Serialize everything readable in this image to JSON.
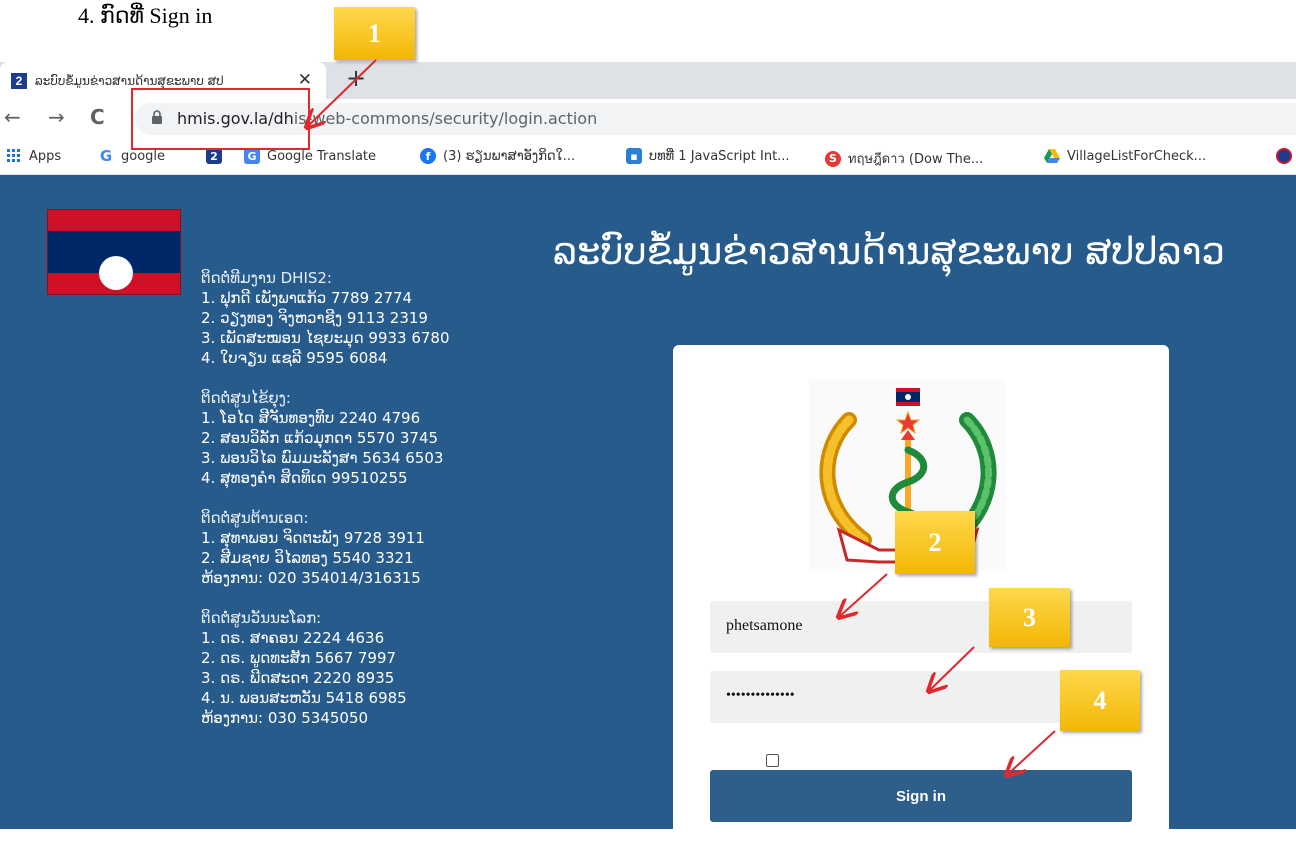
{
  "caption": "4. ກົດທີ່ Sign in",
  "browser": {
    "tab": {
      "favicon": "2",
      "title": "ລະບົບຂໍ້ມູນຂ່າວສານດ້ານສຸຂະພາບ ສປ",
      "close": "✕"
    },
    "new_tab": "+",
    "nav": {
      "back": "←",
      "forward": "→",
      "reload": "C"
    },
    "url_host": "hmis.gov.la/dh",
    "url_path": "is-web-commons/security/login.action",
    "bookmarks": [
      {
        "icon": "apps-grid-icon",
        "label": "Apps"
      },
      {
        "icon": "google-icon",
        "label": "google"
      },
      {
        "icon": "dhis2-icon",
        "label": ""
      },
      {
        "icon": "google-translate-icon",
        "label": "Google Translate"
      },
      {
        "icon": "facebook-icon",
        "label": "(3) ຮຽນພາສາອັງກິດໃ..."
      },
      {
        "icon": "site-icon",
        "label": "ບທທີ່ 1 JavaScript Int..."
      },
      {
        "icon": "si-icon",
        "label": "ทฤษฎีดาว (Dow The..."
      },
      {
        "icon": "google-drive-icon",
        "label": "VillageListForCheck..."
      }
    ]
  },
  "page": {
    "title": "ລະບົບຂໍ້ມູນຂ່າວສານດ້ານສຸຂະພາບ ສປປລາວ",
    "contact_groups": [
      {
        "heading": "ຕິດຕໍ່ທີມງານ DHIS2:",
        "lines": [
          "1. ຟຸກດີ ເພັງພາແກ້ວ 7789 2774",
          "2. ວຽງທອງ ຈິງຫວາຊີງ 9113 2319",
          "3. ເພັດສະໝອນ ໄຊຍະມຸດ 9933 6780",
          "4. ໃບຈຽນ ແຊລີ 9595 6084"
        ]
      },
      {
        "heading": "ຕິດຕໍ່ສູນໄຂ້ຍຸງ:",
        "lines": [
          "1. ໂອໄດ ສີຈັນທອງທິບ 2240 4796",
          "2. ສອນວິລັກ ແກ້ວມຸກດາ 5570 3745",
          "3. ພອນວິໄລ ພົມມະລັງສາ 5634 6503",
          "4. ສຸທອງຄຳ ສິດທິເດ 99510255"
        ]
      },
      {
        "heading": "ຕິດຕໍ່ສູນຕ້ານເອດ:",
        "lines": [
          "1. ສຸທາພອນ ຈິດຕະພັງ 9728 3911",
          "2. ສີມຊາຍ ວິໄລທອງ 5540 3321",
          "ຫ້ອງການ: 020 354014/316315"
        ]
      },
      {
        "heading": "ຕິດຕໍ່ສູນວັນນະໂລກ:",
        "lines": [
          "1. ດຣ. ສາຄອນ 2224 4636",
          "2. ດຣ. ພູດທະສັກ 5667 7997",
          "3. ດຣ. ພີດສະດາ 2220 8935",
          "4. ນ. ພອນສະຫວັນ 5418 6985",
          "ຫ້ອງການ: 030 5345050"
        ]
      }
    ],
    "login": {
      "username_value": "phetsamone",
      "password_value": "••••••••••••••",
      "remember_checked": false,
      "signin_label": "Sign in"
    }
  },
  "annotations": {
    "badges": [
      "1",
      "2",
      "3",
      "4"
    ],
    "highlight_color": "#e0282d",
    "badge_color": "#f2b705"
  },
  "colors": {
    "page_bg": "#275b8c",
    "signin_bg": "#2d5f8a",
    "flag_red": "#ce1126",
    "flag_blue": "#002868"
  }
}
